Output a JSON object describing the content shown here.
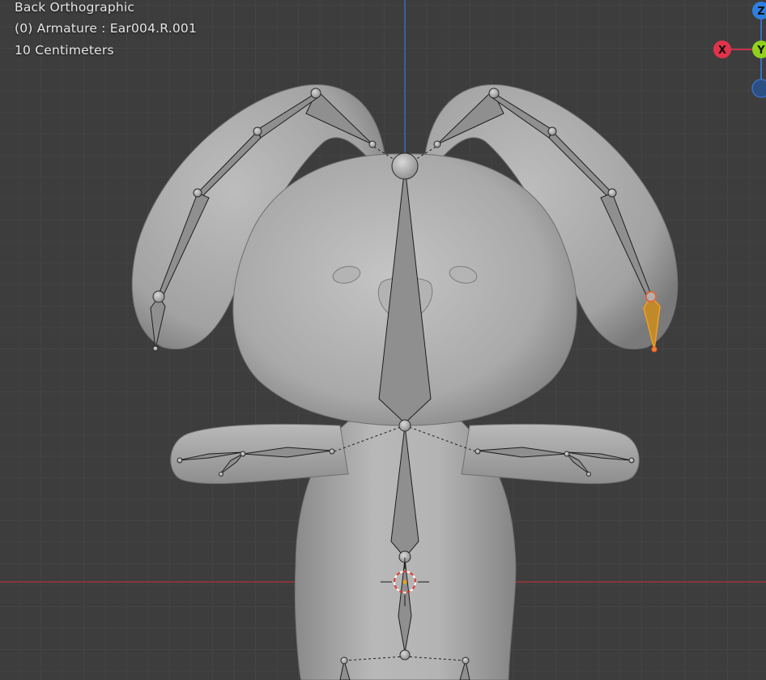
{
  "viewport": {
    "view_name": "Back Orthographic",
    "active_object": "(0) Armature : Ear004.R.001",
    "grid_scale": "10 Centimeters"
  },
  "gizmo": {
    "x_label": "X",
    "y_label": "Y",
    "z_label": "Z",
    "x_color": "#e0334a",
    "y_color": "#8fd11d",
    "z_color": "#2f7fe0"
  },
  "colors": {
    "background": "#3d3d3d",
    "grid": "#444444",
    "x_axis_line": "#b0363e",
    "z_axis_line": "#3a6fc4",
    "selected_bone": "#f0a020"
  },
  "icons": {
    "cursor": "3d-cursor-icon"
  }
}
